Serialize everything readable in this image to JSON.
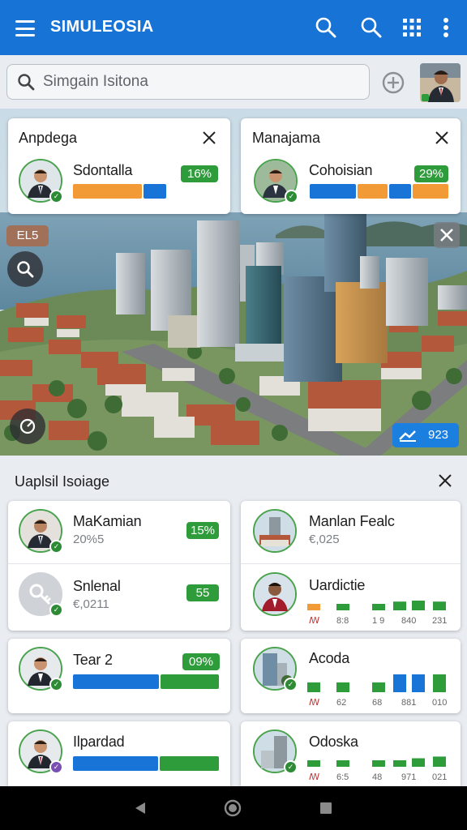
{
  "app": {
    "title": "SIMULEOSIA"
  },
  "colors": {
    "primary": "#1873d6",
    "green": "#2f9c3b",
    "orange": "#f29a36",
    "blue": "#1874d6",
    "panel": "#e9edf1"
  },
  "header_actions": [
    "search-icon",
    "search-icon",
    "grid-icon",
    "more-vert-icon"
  ],
  "search": {
    "placeholder": "Simgain Isitona",
    "value": ""
  },
  "map_overlay": {
    "tag": "EL5",
    "stat": "923"
  },
  "top_cards": [
    {
      "title": "Anpdega",
      "name": "Sdontalla",
      "percent": "16%",
      "bars": [
        {
          "color": "orange",
          "fraction": 0.74
        },
        {
          "color": "blue",
          "fraction": 0.26
        }
      ]
    },
    {
      "title": "Manajama",
      "name": "Cohoisian",
      "percent": "29%",
      "bars": [
        {
          "color": "blue",
          "fraction": 0.34
        },
        {
          "color": "orange",
          "fraction": 0.22
        },
        {
          "color": "blue",
          "fraction": 0.16
        },
        {
          "color": "orange",
          "fraction": 0.28
        }
      ]
    }
  ],
  "section": {
    "title": "Uaplsil Isoiage"
  },
  "list_left": [
    {
      "name": "MaKamian",
      "sub": "20%5",
      "badge": "15%"
    },
    {
      "name": "Snlenal",
      "sub": "€,0211",
      "badge": "55"
    },
    {
      "name": "Tear 2",
      "badge": "09%",
      "bars": [
        {
          "color": "blue",
          "fraction": 0.6
        },
        {
          "color": "green",
          "fraction": 0.4
        }
      ]
    },
    {
      "name": "Ilpardad",
      "bars": [
        {
          "color": "blue",
          "fraction": 0.58
        },
        {
          "color": "green",
          "fraction": 0.42
        }
      ]
    }
  ],
  "list_right": [
    {
      "name": "Manlan Fealc",
      "sub": "€,025"
    },
    {
      "name": "Uardictie",
      "labels": [
        "ꟿ",
        "8:8",
        "1 9",
        "840",
        "231"
      ],
      "levels": [
        0.35,
        0.35,
        0.35,
        0.9,
        1.0,
        0.9
      ],
      "level_colors": [
        "orange",
        "green",
        "green",
        "green",
        "green",
        "green"
      ]
    },
    {
      "name": "Acoda",
      "labels": [
        "ꟿ",
        "62",
        "68",
        "881",
        "010"
      ],
      "levels": [
        0.55,
        0.55,
        0.55,
        1.0,
        1.0,
        1.0
      ],
      "level_colors": [
        "green",
        "green",
        "green",
        "blue",
        "blue",
        "green"
      ]
    },
    {
      "name": "Odoska",
      "labels": [
        "ꟿ",
        "6:5",
        "48",
        "971",
        "021"
      ],
      "levels": [
        0.35,
        0.35,
        0.35,
        0.35,
        0.75,
        0.9
      ],
      "level_colors": [
        "green",
        "green",
        "green",
        "green",
        "green",
        "green"
      ]
    }
  ]
}
